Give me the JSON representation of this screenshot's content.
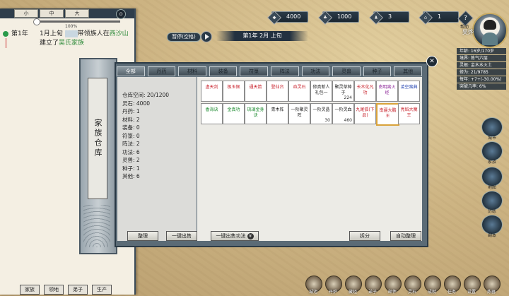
{
  "top_bar": {
    "resources": [
      {
        "icon": "spirit-stone-icon",
        "value": "4000"
      },
      {
        "icon": "food-icon",
        "value": "1000"
      },
      {
        "icon": "population-icon",
        "value": "3"
      },
      {
        "icon": "building-icon",
        "value": "1"
      }
    ],
    "help_label": "帮助",
    "help_icon": "?",
    "speed_label": "暂停(空格)",
    "date": "第1年 2月 上旬"
  },
  "player": {
    "name": "吴烨",
    "stats": [
      "年龄: 16岁/170岁",
      "境界: 炼气六层",
      "灵根: 金木水火土",
      "修为: 21/9785",
      "每年: +7+(-30.00%)",
      "突破几率: 6%"
    ]
  },
  "log_panel": {
    "size_buttons": [
      "小",
      "中",
      "大"
    ],
    "progress_text": "100%",
    "progress": 1.0,
    "entry": {
      "year": "第1年",
      "text_a": "1月上旬",
      "hidden_name": "某某",
      "text_b": "带领族人在",
      "place": "西沙山",
      "text_c": "建立了",
      "clan": "吴氏家族"
    },
    "bottom_nav": [
      "家族",
      "领地",
      "弟子",
      "生产"
    ]
  },
  "right_icons": [
    "城市",
    "家族",
    "地图",
    "历练",
    "副本"
  ],
  "bottom_icons": [
    "城池",
    "丹炉",
    "藏经",
    "弟子",
    "邮件",
    "灵石",
    "成就",
    "任务",
    "设置",
    "炼器",
    "排行"
  ],
  "warehouse": {
    "title": "家族仓库",
    "tabs": [
      "全部",
      "丹药",
      "材料",
      "装备",
      "符箓",
      "阵法",
      "功法",
      "灵兽",
      "种子",
      "其他"
    ],
    "active_tab": "全部",
    "summary": [
      "仓库空间: 20/1200",
      "灵石: 4000",
      "丹药: 1",
      "材料: 2",
      "装备: 0",
      "符箓: 0",
      "阵法: 2",
      "功法: 6",
      "灵兽: 2",
      "种子: 1",
      "其他: 6"
    ],
    "items": [
      {
        "name": "虚天剑",
        "color": "red",
        "qty": ""
      },
      {
        "name": "极玉佩",
        "color": "red",
        "qty": ""
      },
      {
        "name": "通天箭",
        "color": "red",
        "qty": ""
      },
      {
        "name": "登仙台",
        "color": "red",
        "qty": ""
      },
      {
        "name": "血灵石",
        "color": "red",
        "qty": ""
      },
      {
        "name": "修真新人礼包一",
        "color": "black",
        "qty": ""
      },
      {
        "name": "聚灵草种子",
        "color": "black",
        "qty": "224"
      },
      {
        "name": "长木化凡功",
        "color": "red",
        "qty": ""
      },
      {
        "name": "南明离火经",
        "color": "purple",
        "qty": ""
      },
      {
        "name": "凌空蛮典",
        "color": "blue",
        "qty": ""
      },
      {
        "name": "香海诀",
        "color": "green",
        "qty": ""
      },
      {
        "name": "金真功",
        "color": "green",
        "qty": ""
      },
      {
        "name": "琉璃金身诀",
        "color": "green",
        "qty": ""
      },
      {
        "name": "青木阵",
        "color": "black",
        "qty": ""
      },
      {
        "name": "一阶聚灵阵",
        "color": "black",
        "qty": ""
      },
      {
        "name": "一阶灵晶",
        "color": "black",
        "qty": "30"
      },
      {
        "name": "一阶灵血",
        "color": "black",
        "qty": "460"
      },
      {
        "name": "九尾狐(下品)",
        "color": "red",
        "qty": ""
      },
      {
        "name": "南疆大鹏王",
        "color": "red",
        "qty": ""
      },
      {
        "name": "亮焰大魔王",
        "color": "red",
        "qty": ""
      }
    ],
    "selected_item": 18,
    "buttons": {
      "sort": "整理",
      "sell_all": "一键出售",
      "sell_useless": "一键出售功法",
      "split": "拆分",
      "auto": "自动整理"
    }
  }
}
